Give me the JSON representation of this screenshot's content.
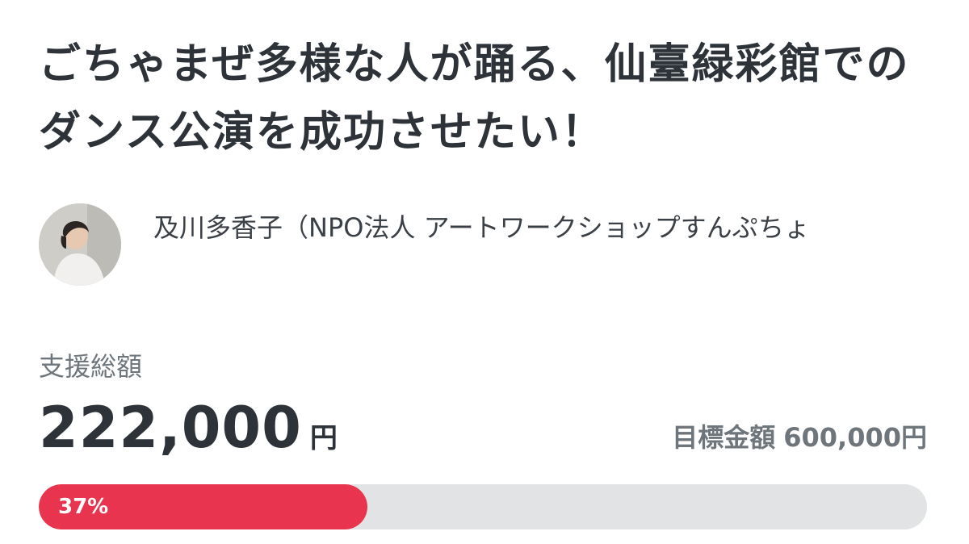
{
  "project": {
    "title": "ごちゃまぜ多様な人が踊る、仙臺緑彩館でのダンス公演を成功させたい！"
  },
  "owner": {
    "avatar_icon": "person-photo-icon",
    "name": "及川多香子（NPO法人 アートワークショップすんぷちょ"
  },
  "funding": {
    "label": "支援総額",
    "amount": "222,000",
    "unit": "円",
    "goal_label": "目標金額",
    "goal_amount": "600,000円",
    "progress_label": "37%",
    "progress_fraction": 0.37
  },
  "colors": {
    "accent": "#e8344e",
    "track": "#e1e3e5",
    "text_primary": "#2d3338",
    "text_secondary": "#6e757b"
  }
}
